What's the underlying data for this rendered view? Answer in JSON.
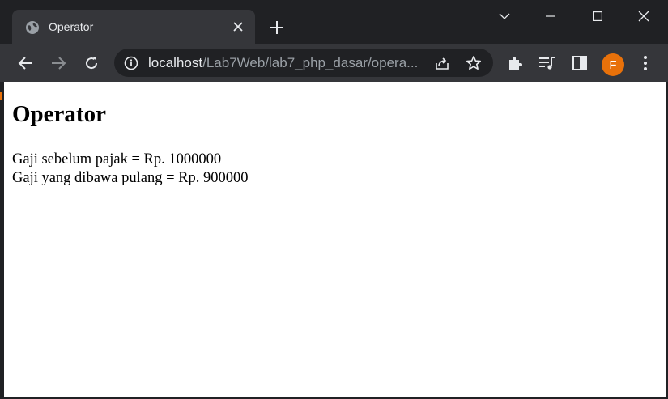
{
  "tab": {
    "title": "Operator"
  },
  "omnibox": {
    "host": "localhost",
    "path": "/Lab7Web/lab7_php_dasar/opera..."
  },
  "profile": {
    "initial": "F"
  },
  "page": {
    "heading": "Operator",
    "lines": [
      "Gaji sebelum pajak = Rp. 1000000",
      "Gaji yang dibawa pulang = Rp. 900000"
    ]
  },
  "colors": {
    "avatar": "#e8710a",
    "chrome_dark": "#202124",
    "chrome_toolbar": "#35363a"
  },
  "icons": [
    "globe-icon",
    "close-icon",
    "plus-icon",
    "chevron-down-icon",
    "minimize-icon",
    "maximize-icon",
    "window-close-icon",
    "back-arrow-icon",
    "forward-arrow-icon",
    "reload-icon",
    "info-icon",
    "share-icon",
    "star-icon",
    "puzzle-icon",
    "media-queue-icon",
    "side-panel-icon",
    "more-vert-icon"
  ]
}
